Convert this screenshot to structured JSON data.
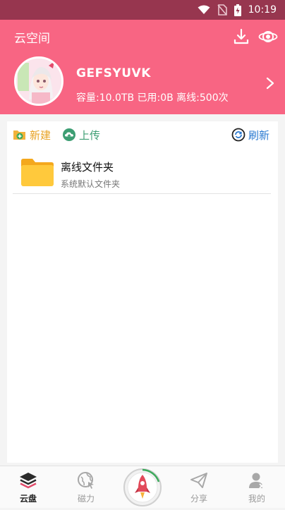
{
  "statusbar": {
    "time": "10:19"
  },
  "header": {
    "title": "云空间",
    "username": "GEFSYUVK",
    "quota": "容量:10.0TB 已用:0B 离线:500次"
  },
  "toolbar": {
    "new_label": "新建",
    "upload_label": "上传",
    "refresh_label": "刷新"
  },
  "files": [
    {
      "name": "离线文件夹",
      "subtitle": "系统默认文件夹"
    }
  ],
  "bottom_nav": [
    {
      "label": "云盘",
      "icon": "layers-icon",
      "active": true
    },
    {
      "label": "磁力",
      "icon": "globe-cursor-icon",
      "active": false
    },
    {
      "label": "",
      "icon": "rocket-icon",
      "active": false
    },
    {
      "label": "分享",
      "icon": "paper-plane-icon",
      "active": false
    },
    {
      "label": "我的",
      "icon": "user-icon",
      "active": false
    }
  ],
  "colors": {
    "accent": "#f86583",
    "statusbar": "#97364f",
    "folder": "#ffc93c",
    "new": "#e8a325",
    "upload": "#3d9e73",
    "refresh": "#2a7ad1"
  }
}
